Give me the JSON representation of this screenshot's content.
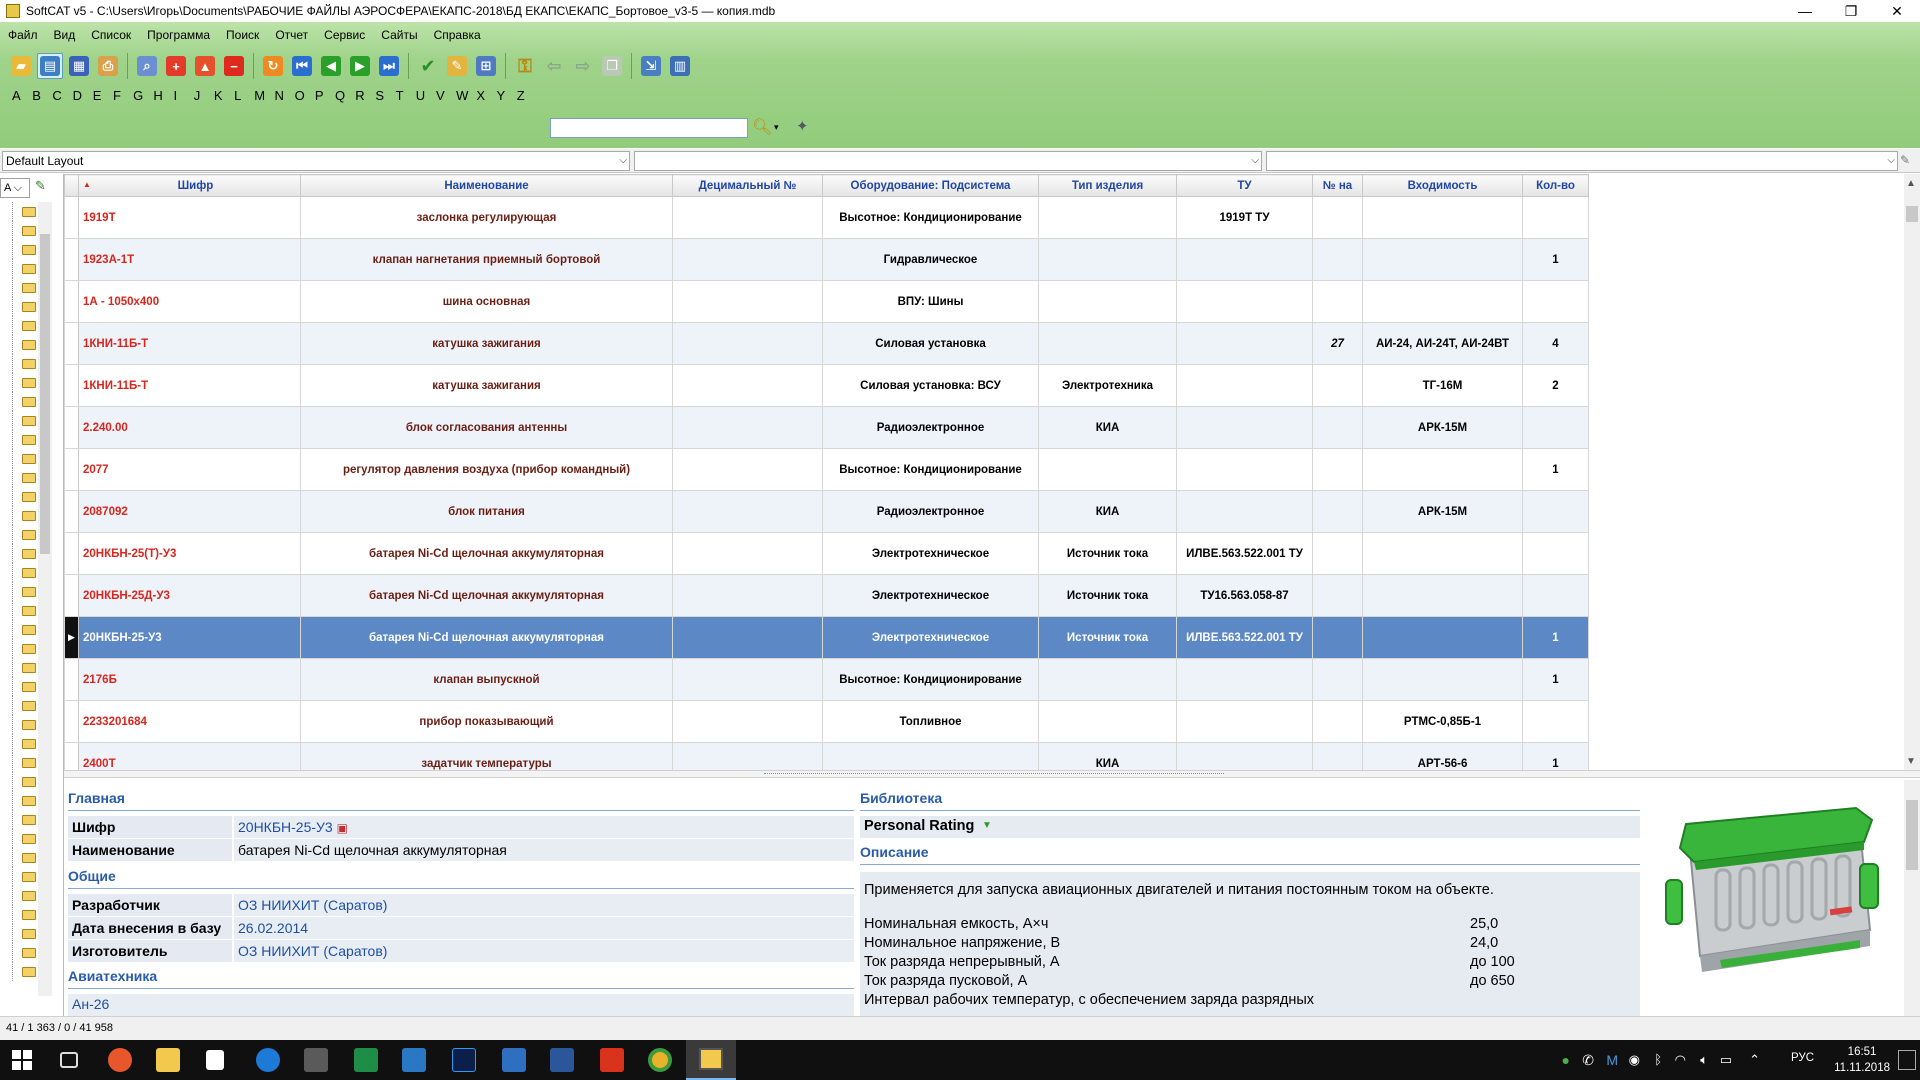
{
  "window": {
    "title": "SoftCAT v5 - C:\\Users\\Игорь\\Documents\\РАБОЧИЕ ФАЙЛЫ АЭРОСФЕРА\\ЕКАПС-2018\\БД ЕКАПС\\ЕКАПС_Бортовое_v3-5 — копия.mdb",
    "minimize": "—",
    "maximize": "❐",
    "close": "✕"
  },
  "menu": [
    "Файл",
    "Вид",
    "Список",
    "Программа",
    "Поиск",
    "Отчет",
    "Сервис",
    "Сайты",
    "Справка"
  ],
  "alphabet": [
    "A",
    "B",
    "C",
    "D",
    "E",
    "F",
    "G",
    "H",
    "I",
    "J",
    "K",
    "L",
    "M",
    "N",
    "O",
    "P",
    "Q",
    "R",
    "S",
    "T",
    "U",
    "V",
    "W",
    "X",
    "Y",
    "Z"
  ],
  "toolbar_icons": [
    "open-folder-icon",
    "database-icon",
    "table-icon",
    "print-preview-icon",
    "search-icon",
    "add-record-icon",
    "move-up-icon",
    "delete-record-icon",
    "refresh-icon",
    "first-record-icon",
    "previous-record-icon",
    "next-record-icon",
    "last-record-icon",
    "apply-check-icon",
    "edit-checklist-icon",
    "grid-view-icon",
    "key-icon",
    "back-arrow-icon",
    "forward-arrow-icon",
    "window-icon",
    "export-icon",
    "report-chart-icon"
  ],
  "search": {
    "value": "",
    "placeholder": ""
  },
  "layout": {
    "selected": "Default Layout",
    "combo2": "",
    "combo3": ""
  },
  "tree_top": "A",
  "grid": {
    "columns": [
      "Шифр",
      "Наименование",
      "Децимальный №",
      "Оборудование: Подсистема",
      "Тип изделия",
      "ТУ",
      "№ на",
      "Входимость",
      "Кол-во"
    ],
    "rows": [
      {
        "code": "1919Т",
        "name": "заслонка регулирующая",
        "dec": "",
        "equip": "Высотное: Кондиционирование",
        "type": "",
        "tu": "1919Т ТУ",
        "no": "",
        "incl": "",
        "qty": ""
      },
      {
        "code": "1923А-1Т",
        "name": "клапан нагнетания приемный бортовой",
        "dec": "",
        "equip": "Гидравлическое",
        "type": "",
        "tu": "",
        "no": "",
        "incl": "",
        "qty": "1"
      },
      {
        "code": "1А - 1050х400",
        "name": "шина основная",
        "dec": "",
        "equip": "ВПУ: Шины",
        "type": "",
        "tu": "",
        "no": "",
        "incl": "",
        "qty": ""
      },
      {
        "code": "1КНИ-11Б-Т",
        "name": "катушка зажигания",
        "dec": "",
        "equip": "Силовая установка",
        "type": "",
        "tu": "",
        "no": "27",
        "incl": "АИ-24, АИ-24Т, АИ-24ВТ",
        "qty": "4"
      },
      {
        "code": "1КНИ-11Б-Т",
        "name": "катушка зажигания",
        "dec": "",
        "equip": "Силовая установка: ВСУ",
        "type": "Электротехника",
        "tu": "",
        "no": "",
        "incl": "ТГ-16М",
        "qty": "2"
      },
      {
        "code": "2.240.00",
        "name": "блок согласования антенны",
        "dec": "",
        "equip": "Радиоэлектронное",
        "type": "КИА",
        "tu": "",
        "no": "",
        "incl": "АРК-15М",
        "qty": ""
      },
      {
        "code": "2077",
        "name": "регулятор давления воздуха (прибор командный)",
        "dec": "",
        "equip": "Высотное: Кондиционирование",
        "type": "",
        "tu": "",
        "no": "",
        "incl": "",
        "qty": "1"
      },
      {
        "code": "2087092",
        "name": "блок питания",
        "dec": "",
        "equip": "Радиоэлектронное",
        "type": "КИА",
        "tu": "",
        "no": "",
        "incl": "АРК-15М",
        "qty": ""
      },
      {
        "code": "20НКБН-25(Т)-У3",
        "name": "батарея Ni-Cd щелочная аккумуляторная",
        "dec": "",
        "equip": "Электротехническое",
        "type": "Источник тока",
        "tu": "ИЛВЕ.563.522.001 ТУ",
        "no": "",
        "incl": "",
        "qty": ""
      },
      {
        "code": "20НКБН-25Д-У3",
        "name": "батарея Ni-Cd щелочная аккумуляторная",
        "dec": "",
        "equip": "Электротехническое",
        "type": "Источник тока",
        "tu": "ТУ16.563.058-87",
        "no": "",
        "incl": "",
        "qty": ""
      },
      {
        "code": "20НКБН-25-У3",
        "name": "батарея Ni-Cd щелочная аккумуляторная",
        "dec": "",
        "equip": "Электротехническое",
        "type": "Источник тока",
        "tu": "ИЛВЕ.563.522.001 ТУ",
        "no": "",
        "incl": "",
        "qty": "1",
        "selected": true
      },
      {
        "code": "2176Б",
        "name": "клапан выпускной",
        "dec": "",
        "equip": "Высотное: Кондиционирование",
        "type": "",
        "tu": "",
        "no": "",
        "incl": "",
        "qty": "1"
      },
      {
        "code": "2233201684",
        "name": "прибор показывающий",
        "dec": "",
        "equip": "Топливное",
        "type": "",
        "tu": "",
        "no": "",
        "incl": "РТМС-0,85Б-1",
        "qty": ""
      },
      {
        "code": "2400Т",
        "name": "задатчик температуры",
        "dec": "",
        "equip": "",
        "type": "КИА",
        "tu": "",
        "no": "",
        "incl": "АРТ-56-6",
        "qty": "1"
      }
    ]
  },
  "detail": {
    "main_header": "Главная",
    "code_label": "Шифр",
    "code_value": "20НКБН-25-У3",
    "name_label": "Наименование",
    "name_value": "батарея Ni-Cd щелочная аккумуляторная",
    "general_header": "Общие",
    "developer_label": "Разработчик",
    "developer_value": "ОЗ НИИХИТ (Саратов)",
    "date_label": "Дата внесения в базу",
    "date_value": "26.02.2014",
    "maker_label": "Изготовитель",
    "maker_value": "ОЗ НИИХИТ (Саратов)",
    "aviation_header": "Авиатехника",
    "aviation_value": "Ан-26",
    "library_header": "Библиотека",
    "rating_label": "Personal Rating",
    "description_header": "Описание",
    "description_text": "Применяется для запуска авиационных двигателей и питания постоянным током на объекте.",
    "specs": [
      {
        "name": "Номинальная емкость, А×ч",
        "value": "25,0"
      },
      {
        "name": "Номинальное напряжение, В",
        "value": "24,0"
      },
      {
        "name": "Ток разряда непрерывный, А",
        "value": "до 100"
      },
      {
        "name": "Ток разряда пусковой, А",
        "value": "до 650"
      },
      {
        "name": "Интервал рабочих температур, с обеспечением заряда разрядных",
        "value": ""
      }
    ]
  },
  "status": "41 / 1 363 / 0 / 41 958",
  "taskbar": {
    "lang": "РУС",
    "time": "16:51",
    "date": "11.11.2018"
  },
  "colors": {
    "green_bar": "#9fd38a",
    "selected_row": "#5c88c6",
    "code_red": "#d7261e",
    "header_blue": "#2147a6"
  }
}
